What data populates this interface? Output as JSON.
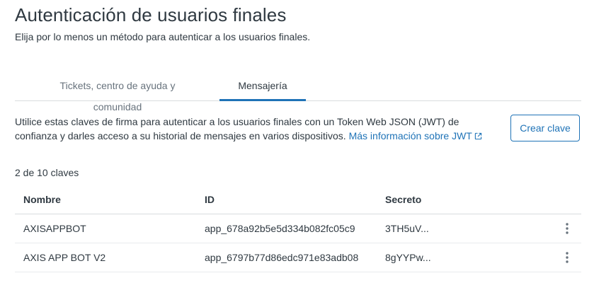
{
  "header": {
    "title": "Autenticación de usuarios finales",
    "subtitle": "Elija por lo menos un método para autenticar a los usuarios finales."
  },
  "tabs": [
    {
      "label": "Tickets, centro de ayuda y comunidad",
      "selected": false
    },
    {
      "label": "Mensajería",
      "selected": true
    }
  ],
  "description": {
    "text": "Utilice estas claves de firma para autenticar a los usuarios finales con un Token Web JSON (JWT) de confianza y darles acceso a su historial de mensajes en varios dispositivos. ",
    "link": "Más información sobre JWT",
    "link_icon": "external-link-icon"
  },
  "create_button": "Crear clave",
  "count": "2 de 10 claves",
  "table": {
    "headers": {
      "name": "Nombre",
      "id": "ID",
      "secret": "Secreto"
    },
    "rows": [
      {
        "name": "AXISAPPBOT",
        "id": "app_678a92b5e5d334b082fc05c9",
        "secret": "3TH5uV..."
      },
      {
        "name": "AXIS APP BOT V2",
        "id": "app_6797b77d86edc971e83adb08",
        "secret": "8gYYPw..."
      }
    ],
    "row_menu_icon": "overflow-menu-icon"
  },
  "colors": {
    "accent": "#1f73b7",
    "text": "#2f3941",
    "muted": "#68737d",
    "border": "#d8dcde"
  }
}
